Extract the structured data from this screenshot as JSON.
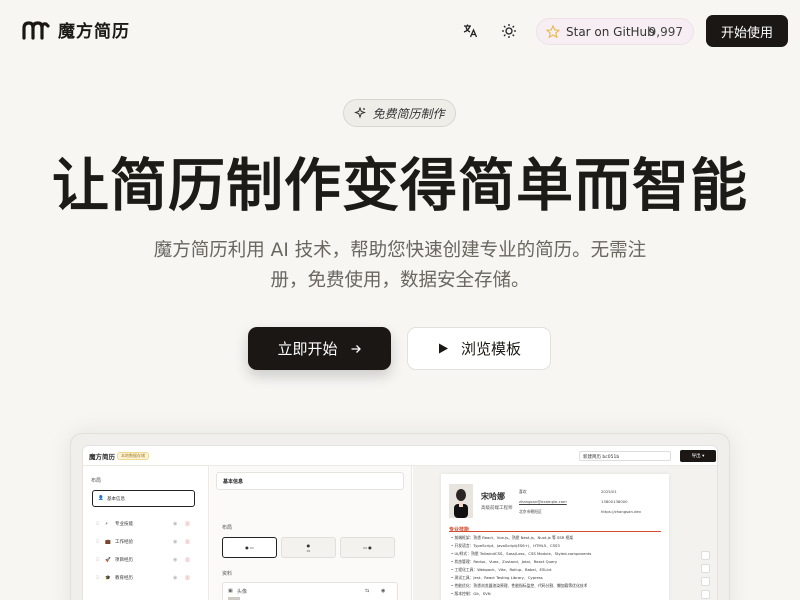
{
  "nav": {
    "logo_text": "魔方简历",
    "star_label": "Star on GitHub",
    "star_count": "9,997",
    "start_label": "开始使用"
  },
  "hero": {
    "badge": "免费简历制作",
    "headline": "让简历制作变得简单而智能",
    "subtext": "魔方简历利用 AI 技术，帮助您快速创建专业的简历。无需注册，免费使用，数据安全存储。",
    "cta_primary": "立即开始",
    "cta_secondary": "浏览模板"
  },
  "preview": {
    "app_title": "魔方简历",
    "app_tag": "本地数据存储",
    "filename": "新建简历 bc051b",
    "export": "导出",
    "left": {
      "layout_label": "布局",
      "items": [
        {
          "label": "基本信息",
          "icon": "user-icon"
        },
        {
          "label": "专业技能",
          "icon": "lightning-icon"
        },
        {
          "label": "工作经验",
          "icon": "briefcase-icon"
        },
        {
          "label": "项目经历",
          "icon": "rocket-icon"
        },
        {
          "label": "教育经历",
          "icon": "graduation-cap-icon"
        }
      ]
    },
    "mid": {
      "section_title": "基本信息",
      "layout_label": "布局",
      "material_label": "资料",
      "avatar_label": "头像"
    },
    "resume": {
      "name": "宋哈娜",
      "role": "高级前端工程师",
      "info": [
        "喜欢",
        "zhangsan@example.com",
        "北京市朝阳区",
        "2025/01",
        "13800138000",
        "https://zhangsan.dev"
      ],
      "section": "专业技能",
      "bullets": [
        "• 前端框架：熟悉 React、Vue.js，熟悉 Next.js、Nuxt.js 等 SSR 框架",
        "• 开发语言：TypeScript、JavaScript(ES6+)、HTML5、CSS3",
        "• UI/样式：熟悉 TailwindCSS、Sass/Less、CSS Module、Styled-components",
        "• 状态管理：Redux、Vuex、Zustand、Jotai、React Query",
        "• 工程化工具：Webpack、Vite、Rollup、Babel、ESLint",
        "• 测试工具：Jest、React Testing Library、Cypress",
        "• 性能优化：熟悉浏览器渲染原理、性能指标监控、代码分割、懒加载等优化技术",
        "• 版本控制：Git、SVN"
      ]
    }
  },
  "colors": {
    "accent_dark": "#1a1714",
    "background": "#f7f6f3",
    "star_yellow": "#e8b84a",
    "resume_accent": "#d34a2c"
  }
}
